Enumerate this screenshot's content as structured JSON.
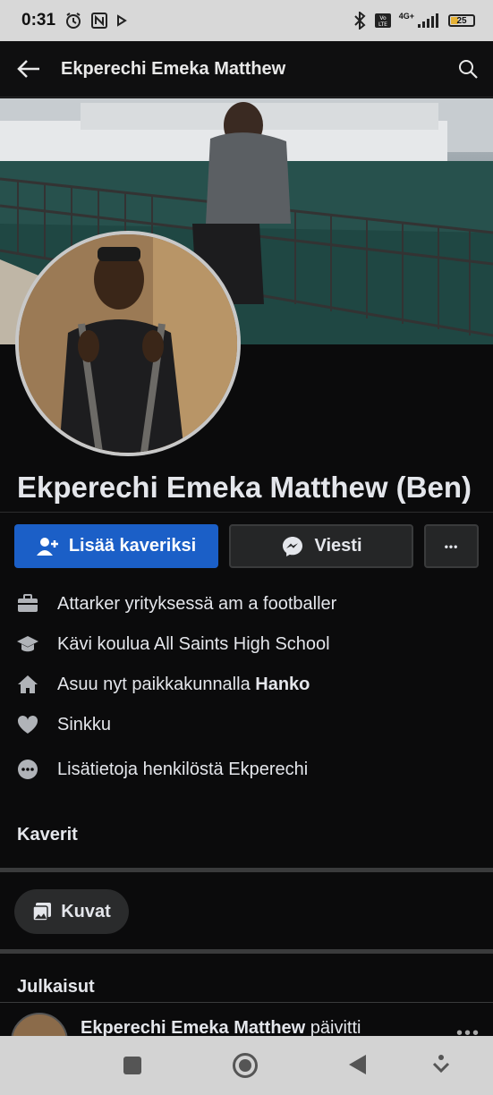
{
  "status_bar": {
    "time": "0:31",
    "battery": "25",
    "network": "4G+",
    "icons": [
      "alarm-icon",
      "nfc-icon",
      "play-icon",
      "bluetooth-icon",
      "volte-icon",
      "signal-icon",
      "battery-icon"
    ]
  },
  "app_bar": {
    "title": "Ekperechi Emeka Matthew",
    "back_icon": "arrow-left-icon",
    "search_icon": "search-icon"
  },
  "profile": {
    "name": "Ekperechi Emeka Matthew (Ben)"
  },
  "actions": {
    "add_friend": "Lisää kaveriksi",
    "message": "Viesti",
    "more": "•••"
  },
  "about": [
    {
      "icon": "briefcase-icon",
      "text": "Attarker yrityksessä am a footballer",
      "bold": ""
    },
    {
      "icon": "graduation-cap-icon",
      "text": "Kävi koulua All Saints High School",
      "bold": ""
    },
    {
      "icon": "home-icon",
      "text": "Asuu nyt paikkakunnalla ",
      "bold": "Hanko"
    },
    {
      "icon": "heart-icon",
      "text": "Sinkku",
      "bold": ""
    },
    {
      "icon": "more-circle-icon",
      "text": "Lisätietoja henkilöstä Ekperechi",
      "bold": ""
    }
  ],
  "sections": {
    "friends": "Kaverit",
    "photos_chip": "Kuvat",
    "posts": "Julkaisut"
  },
  "post": {
    "author": "Ekperechi Emeka Matthew",
    "action": " päivitti"
  },
  "colors": {
    "background": "#0b0b0c",
    "accent": "#1b5fc7",
    "text": "#e4e6eb"
  }
}
